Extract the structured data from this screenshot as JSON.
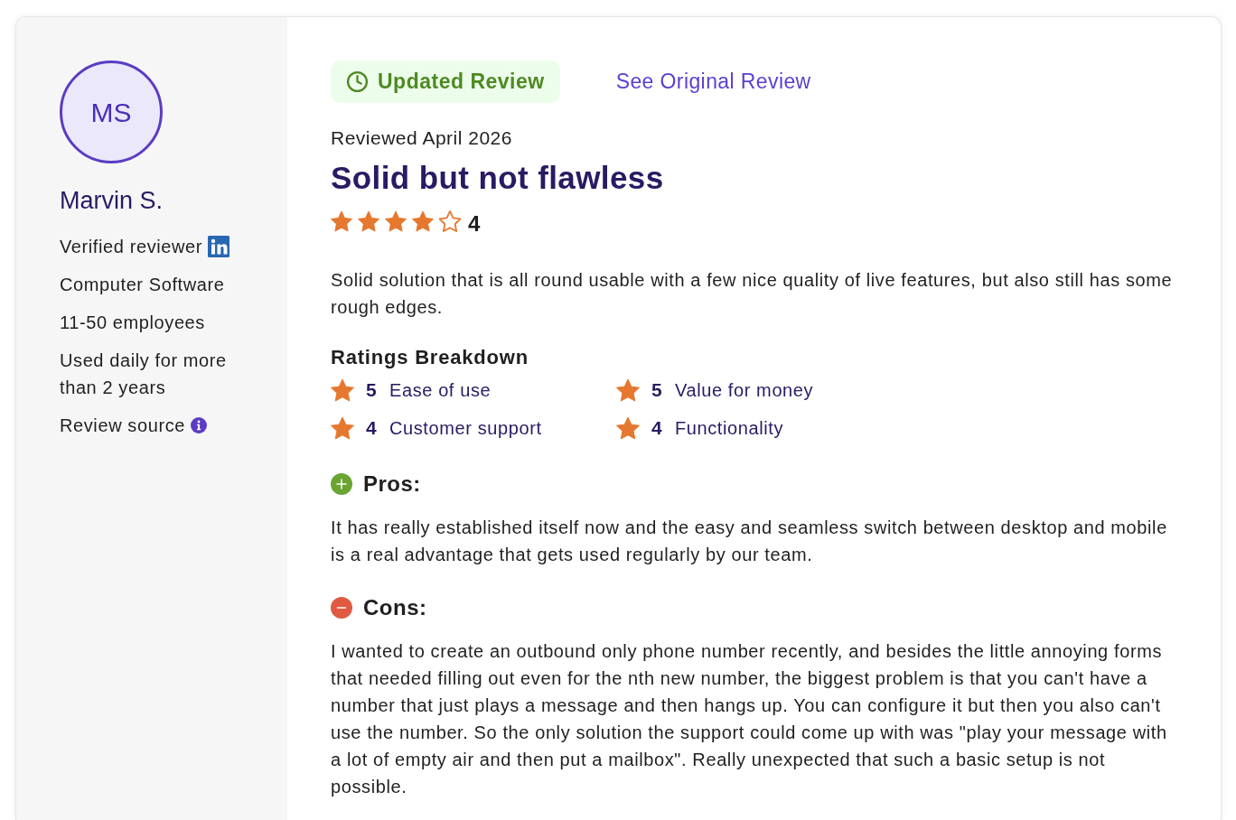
{
  "reviewer": {
    "initials": "MS",
    "name": "Marvin S.",
    "details": [
      {
        "kind": "verified",
        "text": "Verified reviewer"
      },
      {
        "kind": "plain",
        "text": "Computer Software"
      },
      {
        "kind": "plain",
        "text": "11-50 employees"
      },
      {
        "kind": "plain",
        "text": "Used daily for more than 2 years"
      },
      {
        "kind": "info",
        "text": "Review source"
      }
    ]
  },
  "review": {
    "badge": "Updated Review",
    "original_link": "See Original Review",
    "date": "Reviewed April 2026",
    "title": "Solid but not flawless",
    "stars": 4,
    "score": "4",
    "summary": "Solid solution that is all round usable with a few nice quality of live features, but also still has some rough edges.",
    "breakdown": {
      "heading": "Ratings Breakdown",
      "items": [
        {
          "score": "5",
          "label": "Ease of use"
        },
        {
          "score": "5",
          "label": "Value for money"
        },
        {
          "score": "4",
          "label": "Customer support"
        },
        {
          "score": "4",
          "label": "Functionality"
        }
      ]
    },
    "sections": [
      {
        "kind": "pros",
        "heading": "Pros:",
        "text": "It has really established itself now and the easy and seamless switch between desktop and mobile is a real advantage that gets used regularly by our team."
      },
      {
        "kind": "cons",
        "heading": "Cons:",
        "text": "I wanted to create an outbound only phone number recently, and besides the little annoying forms that needed filling out even for the nth new number, the biggest problem is that you can't have a number that just plays a message and then hangs up. You can configure it but then you also can't use the number. So the only solution the support could come up with was \"play your message with a lot of empty air and then put a mailbox\". Really unexpected that such a basic setup is not possible."
      }
    ]
  }
}
